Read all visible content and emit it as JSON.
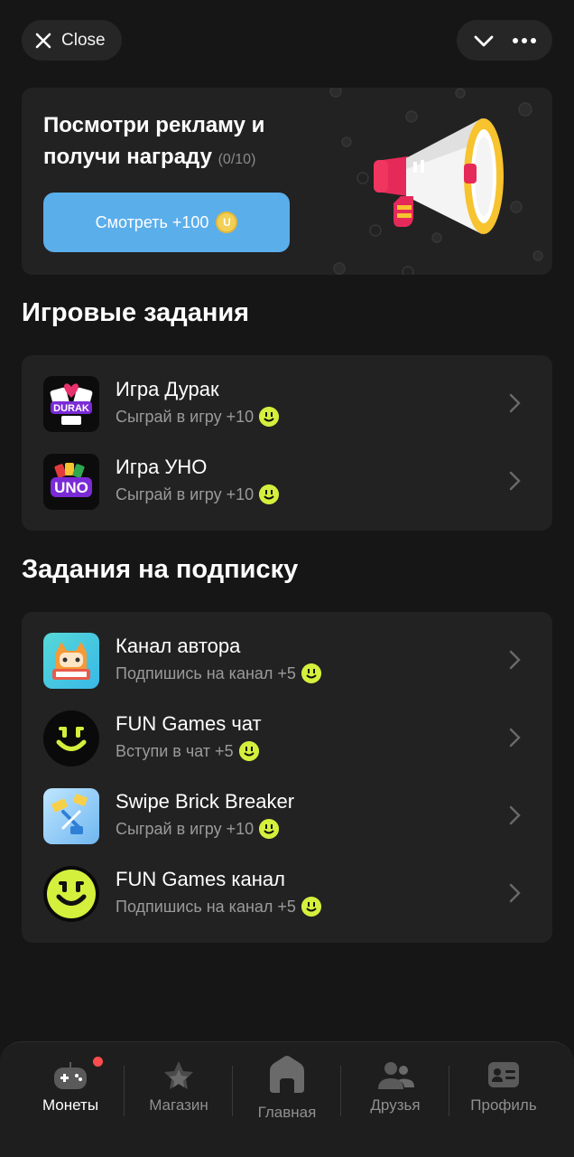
{
  "header": {
    "close_label": "Close"
  },
  "promo": {
    "title": "Посмотри рекламу и получи награду",
    "counter": "(0/10)",
    "button_label": "Смотреть +100",
    "coin_letter": "U"
  },
  "game_tasks": {
    "title": "Игровые задания",
    "items": [
      {
        "title": "Игра Дурак",
        "subtitle": "Сыграй в игру +10",
        "icon": "durak-game-icon"
      },
      {
        "title": "Игра УНО",
        "subtitle": "Сыграй в игру +10",
        "icon": "uno-game-icon"
      }
    ]
  },
  "subscription_tasks": {
    "title": "Задания на подписку",
    "items": [
      {
        "title": "Канал автора",
        "subtitle": "Подпишись на канал +5",
        "icon": "author-channel-icon"
      },
      {
        "title": "FUN Games чат",
        "subtitle": "Вступи в чат +5",
        "icon": "fun-games-chat-icon"
      },
      {
        "title": "Swipe Brick Breaker",
        "subtitle": "Сыграй в игру +10",
        "icon": "swipe-brick-breaker-icon"
      },
      {
        "title": "FUN Games канал",
        "subtitle": "Подпишись на канал +5",
        "icon": "fun-games-channel-icon"
      }
    ]
  },
  "nav": {
    "items": [
      {
        "label": "Монеты",
        "icon": "gamepad-icon",
        "active": true
      },
      {
        "label": "Магазин",
        "icon": "shop-star-icon",
        "active": false
      },
      {
        "label": "Главная",
        "icon": "home-icon",
        "active": false
      },
      {
        "label": "Друзья",
        "icon": "friends-icon",
        "active": false
      },
      {
        "label": "Профиль",
        "icon": "profile-card-icon",
        "active": false
      }
    ]
  },
  "colors": {
    "background": "#161616",
    "card": "#222222",
    "accent_button": "#5aaeea",
    "reward_smile": "#d5ef3d",
    "notification_dot": "#ff4d4d"
  }
}
